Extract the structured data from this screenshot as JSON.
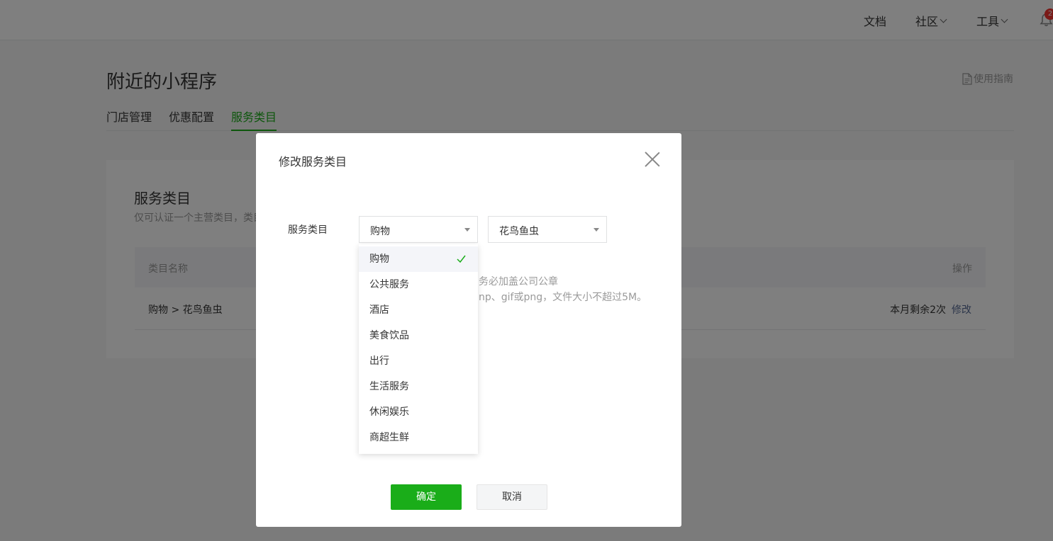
{
  "topbar": {
    "nav": [
      "文档",
      "社区",
      "工具"
    ],
    "notification_count": "2"
  },
  "page": {
    "title": "附近的小程序",
    "guide_link": "使用指南",
    "tabs": [
      "门店管理",
      "优惠配置",
      "服务类目"
    ],
    "active_tab": "服务类目"
  },
  "card": {
    "title": "服务类目",
    "desc": "仅可认证一个主营类目，类目",
    "table": {
      "headers": [
        "类目名称",
        "操作"
      ],
      "rows": [
        {
          "name": "购物 > 花鸟鱼虫",
          "remaining": "本月剩余2次",
          "action": "修改"
        }
      ]
    }
  },
  "dialog": {
    "title": "修改服务类目",
    "field_label": "服务类目",
    "primary_category": "购物",
    "secondary_category": "花鸟鱼虫",
    "tip_line1": "务必加盖公司公章",
    "tip_line2": "np、gif或png，文件大小不超过5M。",
    "dropdown_options": [
      "购物",
      "公共服务",
      "酒店",
      "美食饮品",
      "出行",
      "生活服务",
      "休闲娱乐",
      "商超生鲜"
    ],
    "selected_option": "购物",
    "confirm_label": "确定",
    "cancel_label": "取消"
  },
  "colors": {
    "accent_green": "#1aad19",
    "link_blue": "#576b95",
    "badge_red": "#f43530"
  }
}
